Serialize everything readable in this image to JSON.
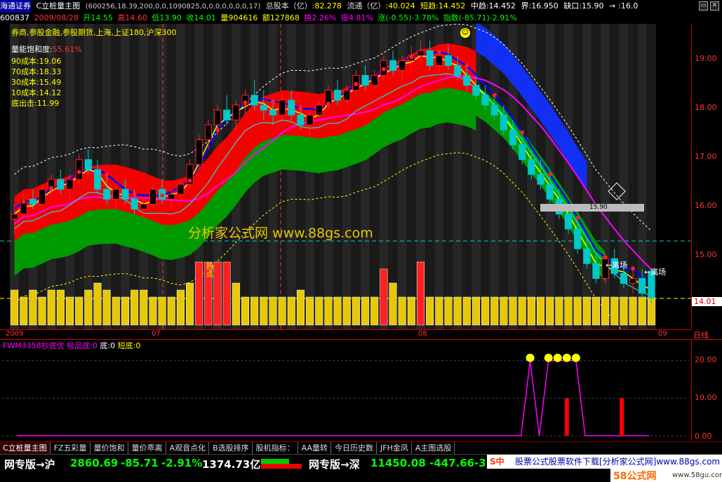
{
  "header": {
    "exchange": "海通证券",
    "indicator": "C立桩量主图",
    "params": "(600256,18.39,200,0,0,1090825,0,0,0,0,0,0,0,17)",
    "total_shares_label": "总股本（亿）",
    "total_shares": ":82.278",
    "float_label": "流通（亿）",
    "float_value": ":40.024",
    "short_trend": "短趋:14.452",
    "mid_trend": "中趋:14.452",
    "boundary": "界:16.950",
    "gap": "缺口:15.90",
    "arrow": "→",
    "last": ":16.0",
    "code": "600837",
    "date": "2009/08/28",
    "open": "开14.55",
    "high": "高14.60",
    "low": "低13.90",
    "close": "收14.01",
    "volume": "量904616",
    "amount": "额127868",
    "turnover": "换2.26%",
    "amplitude": "振4.81%",
    "change": "涨(-0.55)-3.78%",
    "index": "指数(-85.71)-2.91%"
  },
  "overlay": {
    "sectors": "券商,参股金融,参股期货,上海,上证180,沪深300",
    "saturation_label": "量能饱和度:",
    "saturation_value": "55.61%",
    "cost90": "90成本:19.06",
    "cost70": "70成本:18.33",
    "cost30": "30成本:15.49",
    "cost10": "10成本:14.12",
    "bottom": "底出击:11.99",
    "watermark": "分析家公式网 www.88gs.com",
    "hot_point": "热点",
    "price_tag": "14.01",
    "line_tag": "15.90",
    "exit": "离场",
    "daily": "日线"
  },
  "price_axis": {
    "ticks": [
      "19.00",
      "18.00",
      "17.00",
      "16.00",
      "15.00"
    ],
    "current": "14.01"
  },
  "date_axis": [
    "2009",
    "07",
    "08",
    "09"
  ],
  "sub_indicator": {
    "name": "FWM3358抄底优",
    "extreme": "极品底:0",
    "bottom": "底:0",
    "short_bottom": "短底:0",
    "ticks": [
      "20.00",
      "10.00",
      "0.00"
    ]
  },
  "tabs": [
    "C立桩量主图",
    "FZ五彩量",
    "量价饱和",
    "量价乖离",
    "A观音点化",
    "B选股排序",
    "股机指标：",
    "AA量转",
    "今日历史数",
    "JFH金凤",
    "A主图选股"
  ],
  "status": {
    "sh_label": "网专版→沪",
    "sh_index": "2860.69",
    "sh_change": "-85.71",
    "sh_pct": "-2.91%",
    "sh_amount": "1374.73亿",
    "sz_label": "网专版→深",
    "sz_index": "11450.08",
    "sz_change": "-447.66",
    "sz_pct": "-3",
    "ad_text": "股票公式股票软件下载[分析家公式网]www.88gs.com",
    "brand": "58公式网",
    "brand_url": "www.58gu.com"
  },
  "colors": {
    "red_candle": "#ff2020",
    "green_candle": "#00c8c8",
    "band_red": "#ff0000",
    "band_green": "#00a000",
    "band_blue": "#1030ff",
    "volume_yellow": "#e8c800"
  },
  "chart_data": {
    "type": "candlestick",
    "ylim": [
      13.6,
      19.4
    ],
    "candles": [
      [
        15.6,
        15.9,
        15.3,
        15.7
      ],
      [
        15.7,
        16.1,
        15.6,
        16.0
      ],
      [
        16.0,
        16.2,
        15.8,
        15.9
      ],
      [
        15.9,
        16.3,
        15.8,
        16.2
      ],
      [
        16.2,
        16.5,
        16.0,
        16.4
      ],
      [
        16.4,
        16.6,
        16.1,
        16.2
      ],
      [
        16.2,
        16.5,
        16.0,
        16.4
      ],
      [
        16.4,
        16.9,
        16.3,
        16.8
      ],
      [
        16.8,
        17.0,
        16.5,
        16.6
      ],
      [
        16.6,
        16.8,
        16.1,
        16.2
      ],
      [
        16.2,
        16.5,
        15.9,
        16.0
      ],
      [
        16.0,
        16.3,
        15.8,
        16.2
      ],
      [
        16.2,
        16.4,
        15.9,
        16.0
      ],
      [
        16.0,
        16.2,
        15.7,
        15.8
      ],
      [
        15.8,
        16.0,
        15.6,
        15.9
      ],
      [
        15.9,
        16.3,
        15.8,
        16.2
      ],
      [
        16.2,
        16.4,
        15.9,
        16.0
      ],
      [
        16.0,
        16.2,
        15.8,
        16.1
      ],
      [
        16.1,
        16.4,
        15.9,
        16.3
      ],
      [
        16.3,
        16.8,
        16.2,
        16.7
      ],
      [
        16.7,
        17.3,
        16.6,
        17.2
      ],
      [
        17.2,
        17.6,
        17.0,
        17.5
      ],
      [
        17.5,
        17.9,
        17.3,
        17.8
      ],
      [
        17.8,
        18.1,
        17.5,
        17.6
      ],
      [
        17.6,
        18.0,
        17.4,
        17.9
      ],
      [
        17.9,
        18.2,
        17.7,
        18.1
      ],
      [
        18.1,
        18.4,
        17.8,
        17.9
      ],
      [
        17.9,
        18.2,
        17.6,
        17.8
      ],
      [
        17.8,
        18.0,
        17.5,
        17.7
      ],
      [
        17.7,
        18.1,
        17.6,
        18.0
      ],
      [
        18.0,
        18.2,
        17.6,
        17.7
      ],
      [
        17.7,
        17.9,
        17.4,
        17.5
      ],
      [
        17.5,
        17.8,
        17.3,
        17.7
      ],
      [
        17.7,
        18.0,
        17.6,
        17.9
      ],
      [
        17.9,
        18.3,
        17.8,
        18.2
      ],
      [
        18.2,
        18.4,
        17.9,
        18.0
      ],
      [
        18.0,
        18.3,
        17.9,
        18.2
      ],
      [
        18.2,
        18.6,
        18.1,
        18.5
      ],
      [
        18.5,
        18.7,
        18.2,
        18.3
      ],
      [
        18.3,
        18.6,
        18.2,
        18.5
      ],
      [
        18.5,
        18.9,
        18.4,
        18.8
      ],
      [
        18.8,
        19.0,
        18.5,
        18.6
      ],
      [
        18.6,
        18.9,
        18.4,
        18.8
      ],
      [
        18.8,
        19.1,
        18.6,
        18.9
      ],
      [
        18.9,
        19.2,
        18.7,
        19.0
      ],
      [
        19.0,
        19.2,
        18.6,
        18.7
      ],
      [
        18.7,
        19.0,
        18.5,
        18.9
      ],
      [
        18.9,
        19.1,
        18.6,
        18.7
      ],
      [
        18.7,
        18.9,
        18.4,
        18.5
      ],
      [
        18.5,
        18.7,
        18.2,
        18.3
      ],
      [
        18.3,
        18.5,
        18.0,
        18.1
      ],
      [
        18.1,
        18.3,
        17.8,
        17.9
      ],
      [
        17.9,
        18.1,
        17.6,
        17.7
      ],
      [
        17.7,
        17.9,
        17.3,
        17.4
      ],
      [
        17.4,
        17.6,
        17.0,
        17.1
      ],
      [
        17.1,
        17.3,
        16.7,
        16.8
      ],
      [
        16.8,
        17.0,
        16.4,
        16.5
      ],
      [
        16.5,
        16.8,
        16.2,
        16.3
      ],
      [
        16.3,
        16.5,
        15.9,
        16.0
      ],
      [
        16.0,
        16.2,
        15.6,
        15.7
      ],
      [
        15.7,
        15.9,
        15.3,
        15.4
      ],
      [
        15.4,
        15.6,
        14.9,
        15.0
      ],
      [
        15.0,
        15.2,
        14.6,
        14.7
      ],
      [
        14.7,
        14.9,
        14.3,
        14.4
      ],
      [
        14.4,
        14.9,
        14.3,
        14.8
      ],
      [
        14.8,
        15.0,
        14.4,
        14.5
      ],
      [
        14.5,
        14.7,
        14.2,
        14.3
      ],
      [
        14.3,
        14.6,
        14.1,
        14.4
      ],
      [
        14.4,
        14.6,
        14.0,
        14.1
      ],
      [
        14.55,
        14.6,
        13.9,
        14.01
      ]
    ],
    "volumes": [
      5,
      4,
      5,
      4,
      5,
      5,
      4,
      4,
      5,
      6,
      5,
      4,
      4,
      5,
      5,
      4,
      4,
      4,
      5,
      6,
      9,
      9,
      9,
      9,
      6,
      4,
      4,
      4,
      4,
      4,
      4,
      5,
      4,
      4,
      4,
      4,
      4,
      4,
      4,
      4,
      8,
      6,
      4,
      4,
      9,
      4,
      4,
      4,
      4,
      4,
      4,
      4,
      4,
      4,
      4,
      4,
      4,
      4,
      4,
      4,
      4,
      4,
      4,
      4,
      4,
      4,
      4,
      4,
      4,
      4
    ],
    "sub_values": [
      0,
      0,
      0,
      0,
      0,
      0,
      0,
      0,
      0,
      0,
      0,
      0,
      0,
      0,
      0,
      0,
      0,
      0,
      0,
      0,
      0,
      0,
      0,
      0,
      0,
      0,
      0,
      0,
      0,
      0,
      0,
      0,
      0,
      0,
      0,
      0,
      0,
      0,
      0,
      0,
      0,
      0,
      0,
      0,
      0,
      0,
      0,
      0,
      0,
      0,
      0,
      0,
      0,
      0,
      0,
      0,
      20,
      0,
      20,
      20,
      20,
      20,
      0,
      0,
      0,
      0,
      0,
      0,
      0,
      0
    ],
    "sub_spikes": [
      0,
      0,
      0,
      0,
      0,
      0,
      0,
      0,
      0,
      0,
      0,
      0,
      0,
      0,
      0,
      0,
      0,
      0,
      0,
      0,
      0,
      0,
      0,
      0,
      0,
      0,
      0,
      0,
      0,
      0,
      0,
      0,
      0,
      0,
      0,
      0,
      0,
      0,
      0,
      0,
      0,
      0,
      0,
      0,
      0,
      0,
      0,
      0,
      0,
      0,
      0,
      0,
      0,
      0,
      0,
      0,
      0,
      0,
      0,
      0,
      10,
      0,
      0,
      0,
      0,
      0,
      10,
      0,
      0,
      0
    ]
  }
}
